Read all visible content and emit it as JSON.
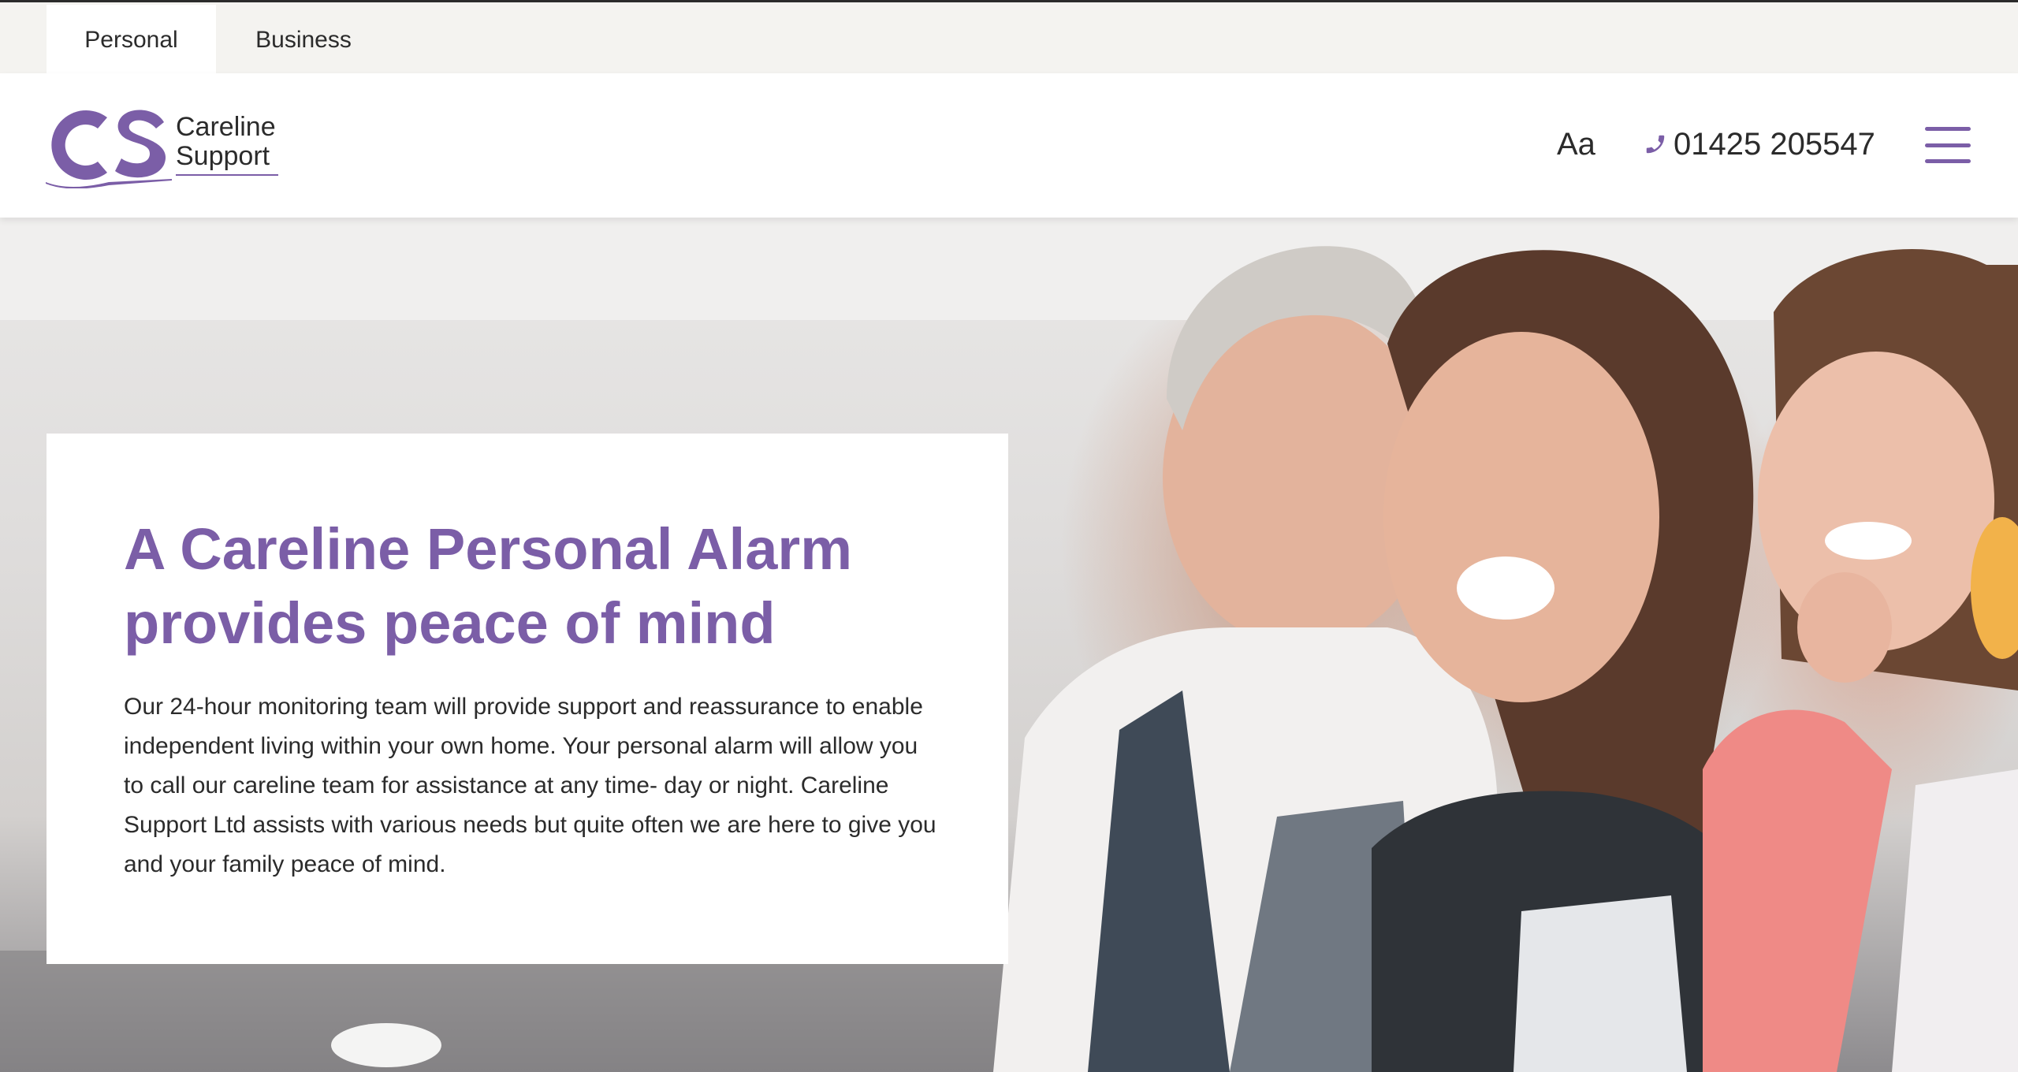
{
  "segment_tabs": {
    "personal": "Personal",
    "business": "Business"
  },
  "logo": {
    "monogram": "CS",
    "line1": "Careline",
    "line2": "Support"
  },
  "header": {
    "font_size_toggle": "Aa",
    "phone_number": "01425 205547",
    "menu_icon": "hamburger-icon",
    "phone_icon": "phone-icon"
  },
  "hero": {
    "title": "A Careline Personal Alarm provides peace of mind",
    "body": "Our 24-hour monitoring team will provide support and reassurance to enable independent living within your own home. Your personal alarm will allow you to call our careline team for assistance at any time- day or night. Careline Support Ltd assists with various needs but quite often we are here to give you and your family peace of mind."
  },
  "colors": {
    "brand_purple": "#7b5ea7",
    "text_dark": "#2b2b2b",
    "top_strip": "#f4f3f0"
  }
}
